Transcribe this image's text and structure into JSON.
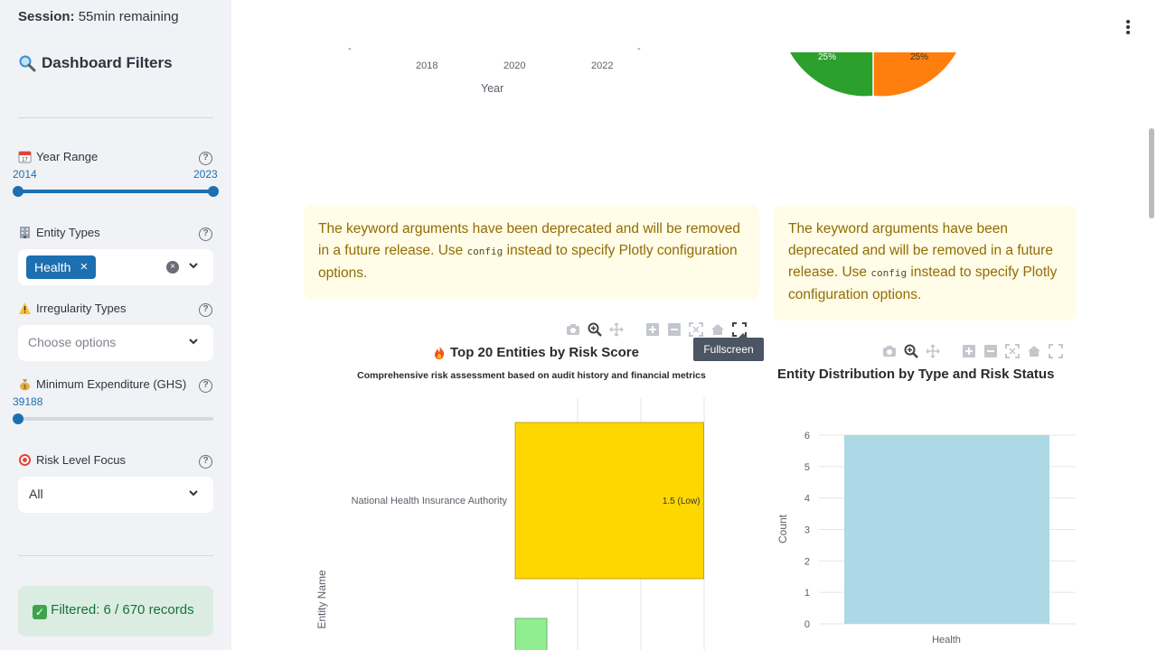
{
  "session": {
    "label": "Session:",
    "value": "55min remaining"
  },
  "sidebar": {
    "title_icon": "magnifier-emoji",
    "title": "Dashboard Filters",
    "year_range": {
      "icon": "calendar-emoji",
      "label": "Year Range",
      "min": "2014",
      "max": "2023",
      "accent": "#1c6fb0"
    },
    "entity_types": {
      "icon": "office-building-emoji",
      "label": "Entity Types",
      "chips": [
        "Health"
      ]
    },
    "irregularity_types": {
      "icon": "warning-emoji",
      "label": "Irregularity Types",
      "placeholder": "Choose options"
    },
    "min_expenditure": {
      "icon": "money-bag-emoji",
      "label": "Minimum Expenditure (GHS)",
      "value": "39188",
      "level": 0.0
    },
    "risk_level": {
      "icon": "target-emoji",
      "label": "Risk Level Focus",
      "value": "All"
    },
    "filtered_status": {
      "icon": "check-emoji",
      "text": "Filtered: 6 / 670 records"
    }
  },
  "top_line_chart": {
    "x_ticks": [
      "2018",
      "2020",
      "2022"
    ],
    "xlabel": "Year"
  },
  "top_pie_chart": {
    "slices": [
      {
        "label": "25%",
        "color": "#2ca02c"
      },
      {
        "label": "25%",
        "color": "#ff7f0e"
      }
    ]
  },
  "warnings": {
    "left": {
      "before": "The keyword arguments have been deprecated and will be removed in a future release. Use ",
      "code": "config",
      "after": " instead to specify Plotly configuration options."
    },
    "right": {
      "before": "The keyword arguments have been deprecated and will be removed in a future release. Use ",
      "code": "config",
      "after": " instead to specify Plotly configuration options."
    }
  },
  "tooltip": "Fullscreen",
  "chart_data": [
    {
      "type": "bar",
      "orientation": "horizontal",
      "title_icon": "fire-emoji",
      "title": "Top 20 Entities by Risk Score",
      "subtitle": "Comprehensive risk assessment based on audit history and financial metrics",
      "ylabel": "Entity Name",
      "categories": [
        "National Health Insurance Authority"
      ],
      "values": [
        1.5
      ],
      "data_labels": [
        "1.5 (Low)"
      ],
      "colors": [
        "#ffd700",
        "#90ee90"
      ],
      "grid": true
    },
    {
      "type": "bar",
      "title": "Entity Distribution by Type and Risk Status",
      "ylabel": "Count",
      "xlabel": "",
      "categories": [
        "Health"
      ],
      "values": [
        6
      ],
      "y_ticks": [
        "0",
        "1",
        "2",
        "3",
        "4",
        "5",
        "6"
      ],
      "ylim": [
        0,
        6
      ],
      "color": "#add8e6",
      "grid": true
    }
  ]
}
